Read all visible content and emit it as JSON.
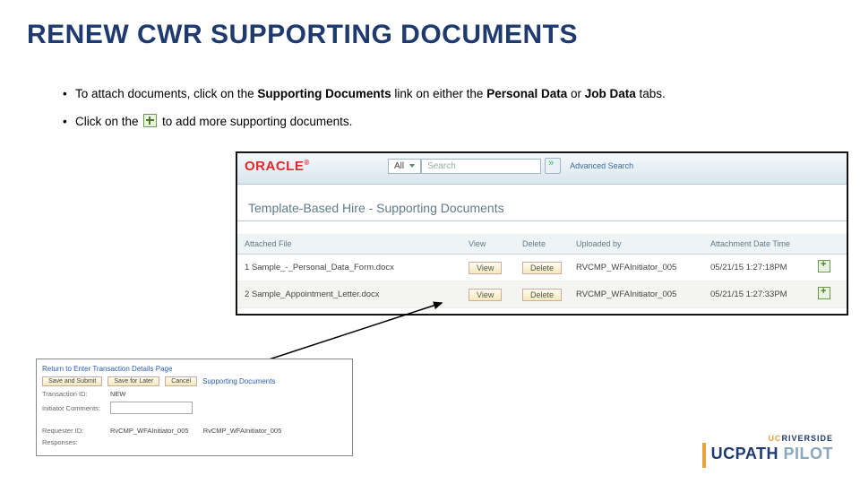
{
  "title": "RENEW CWR SUPPORTING DOCUMENTS",
  "bullets": {
    "b1a": "To attach documents, click on the ",
    "b1b": "Supporting Documents",
    "b1c": " link on either the ",
    "b1d": "Personal Data",
    "b1e": " or ",
    "b1f": "Job Data",
    "b1g": " tabs.",
    "b2a": "Click on the ",
    "b2b": " to add more supporting documents."
  },
  "oracle": {
    "logo": "ORACLE",
    "all": "All",
    "search": "Search",
    "adv": "Advanced Search",
    "heading": "Template-Based Hire - Supporting Documents",
    "cols": {
      "file": "Attached File",
      "view": "View",
      "del": "Delete",
      "by": "Uploaded by",
      "dt": "Attachment Date Time"
    },
    "rows": [
      {
        "n": "1",
        "file": "Sample_-_Personal_Data_Form.docx",
        "view": "View",
        "del": "Delete",
        "by": "RVCMP_WFAInitiator_005",
        "dt": "05/21/15  1:27:18PM"
      },
      {
        "n": "2",
        "file": "Sample_Appointment_Letter.docx",
        "view": "View",
        "del": "Delete",
        "by": "RVCMP_WFAInitiator_005",
        "dt": "05/21/15  1:27:33PM"
      }
    ]
  },
  "popup": {
    "return": "Return to Enter Transaction Details Page",
    "save_submit": "Save and Submit",
    "save_later": "Save for Later",
    "cancel": "Cancel",
    "supporting": "Supporting Documents",
    "tid_lbl": "Transaction ID:",
    "tid": "NEW",
    "comments_lbl": "Initiator Comments:",
    "req_lbl": "Requester ID:",
    "req1": "RvCMP_WFAInitiator_005",
    "req2": "RvCMP_WFAInitiator_005",
    "resp_lbl": "Responses:"
  },
  "footer": {
    "uc": "UC",
    "riv": "RIVERSIDE",
    "ucpath": "UCPATH ",
    "pilot": "PILOT"
  }
}
